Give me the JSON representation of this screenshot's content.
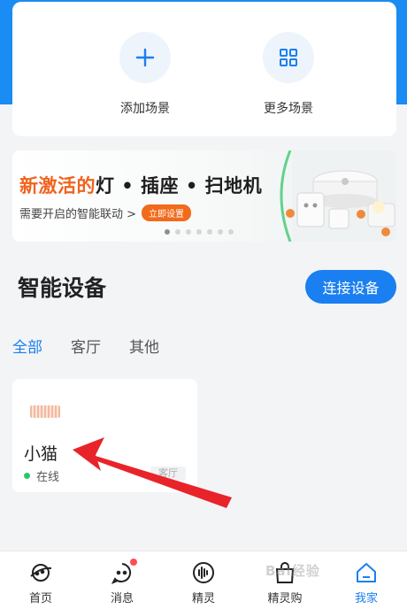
{
  "scenes": [
    {
      "label": "添加场景",
      "icon": "plus-icon"
    },
    {
      "label": "更多场景",
      "icon": "grid-icon"
    }
  ],
  "banner": {
    "title_highlight": "新激活的",
    "title_rest": "灯 • 插座 • 扫地机",
    "subtitle": "需要开启的智能联动 >",
    "button": "立即设置",
    "page_count": 7,
    "active_page": 1
  },
  "devices_section": {
    "title": "智能设备",
    "connect_button": "连接设备"
  },
  "room_tabs": [
    {
      "label": "全部",
      "active": true
    },
    {
      "label": "客厅",
      "active": false
    },
    {
      "label": "其他",
      "active": false
    }
  ],
  "device": {
    "name": "小猫",
    "status": "在线",
    "room": "客厅",
    "status_color": "#2ac769"
  },
  "tabbar": [
    {
      "label": "首页",
      "icon": "planet-icon"
    },
    {
      "label": "消息",
      "icon": "chat-icon",
      "badge": true
    },
    {
      "label": "精灵",
      "icon": "voice-wave-icon"
    },
    {
      "label": "精灵购",
      "icon": "shopping-bag-icon"
    },
    {
      "label": "我家",
      "icon": "house-icon",
      "active": true
    }
  ],
  "watermark": "Bai经验",
  "colors": {
    "accent": "#1a7ff0",
    "header_blue": "#1a8cf4",
    "banner_orange": "#f0631e",
    "annotation_red": "#e8242a"
  }
}
